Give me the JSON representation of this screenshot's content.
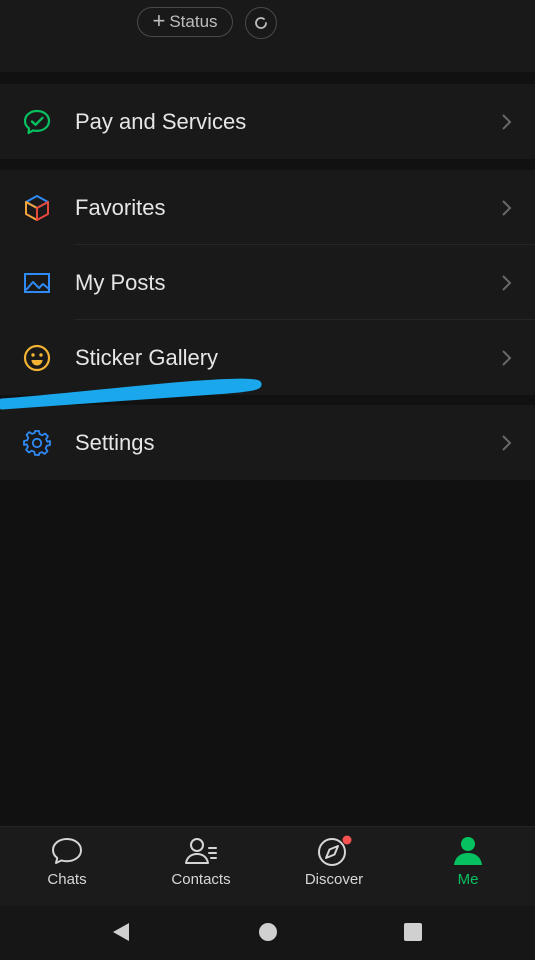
{
  "header": {
    "status_label": "Status",
    "plus_glyph": "+"
  },
  "menu": [
    {
      "label": "Pay and Services",
      "icon": "pay-services-icon",
      "color": "#07c160"
    },
    {
      "label": "Favorites",
      "icon": "favorites-cube-icon",
      "color": "#f2a33c"
    },
    {
      "label": "My Posts",
      "icon": "image-icon",
      "color": "#2f8af5"
    },
    {
      "label": "Sticker Gallery",
      "icon": "smiley-icon",
      "color": "#f2b233"
    },
    {
      "label": "Settings",
      "icon": "gear-icon",
      "color": "#2f8af5"
    }
  ],
  "tabs": [
    {
      "label": "Chats",
      "icon": "chat-bubble-icon"
    },
    {
      "label": "Contacts",
      "icon": "contacts-icon"
    },
    {
      "label": "Discover",
      "icon": "compass-icon"
    },
    {
      "label": "Me",
      "icon": "person-icon",
      "active": true
    }
  ],
  "colors": {
    "accent": "#07c160",
    "annotation": "#1aa7ec",
    "badge": "#fa5151"
  }
}
